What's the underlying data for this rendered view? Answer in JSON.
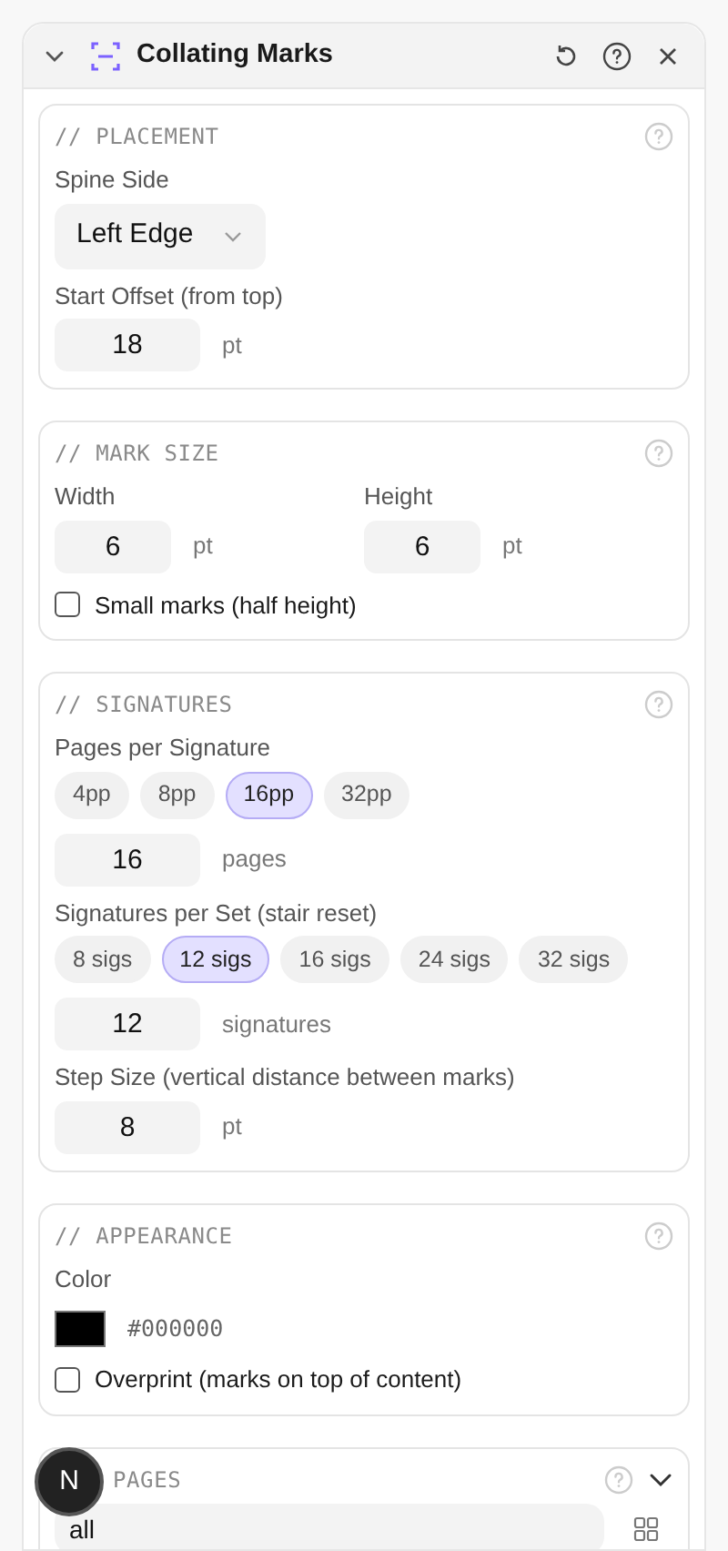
{
  "panel": {
    "title": "Collating Marks",
    "expanded": true
  },
  "sections": [
    {
      "heading": "// PLACEMENT",
      "fields": [
        {
          "kind": "select",
          "label": "Spine Side",
          "value": "Left Edge"
        },
        {
          "kind": "number",
          "label": "Start Offset (from top)",
          "value": "18",
          "unit": "pt"
        }
      ]
    },
    {
      "heading": "// MARK SIZE",
      "fields": [
        {
          "kind": "pair",
          "items": [
            {
              "label": "Width",
              "value": "6",
              "unit": "pt"
            },
            {
              "label": "Height",
              "value": "6",
              "unit": "pt"
            }
          ]
        },
        {
          "kind": "checkbox",
          "label": "Small marks (half height)",
          "checked": false
        }
      ]
    },
    {
      "heading": "// SIGNATURES",
      "fields": [
        {
          "kind": "chips",
          "label": "Pages per Signature",
          "options": [
            {
              "label": "4pp",
              "selected": false
            },
            {
              "label": "8pp",
              "selected": false
            },
            {
              "label": "16pp",
              "selected": true
            },
            {
              "label": "32pp",
              "selected": false
            }
          ]
        },
        {
          "kind": "number",
          "value": "16",
          "unit": "pages"
        },
        {
          "kind": "chips",
          "label": "Signatures per Set (stair reset)",
          "options": [
            {
              "label": "8 sigs",
              "selected": false
            },
            {
              "label": "12 sigs",
              "selected": true
            },
            {
              "label": "16 sigs",
              "selected": false
            },
            {
              "label": "24 sigs",
              "selected": false
            },
            {
              "label": "32 sigs",
              "selected": false
            }
          ]
        },
        {
          "kind": "number",
          "value": "12",
          "unit": "signatures"
        },
        {
          "kind": "number",
          "label": "Step Size (vertical distance between marks)",
          "value": "8",
          "unit": "pt"
        }
      ]
    },
    {
      "heading": "// APPEARANCE",
      "fields": [
        {
          "kind": "color",
          "label": "Color",
          "value": "#000000"
        },
        {
          "kind": "checkbox",
          "label": "Overprint (marks on top of content)",
          "checked": false
        }
      ]
    },
    {
      "heading": "PAGES",
      "collapsible": true,
      "fields": [
        {
          "kind": "text",
          "value": "all"
        }
      ]
    }
  ],
  "badge": "N"
}
